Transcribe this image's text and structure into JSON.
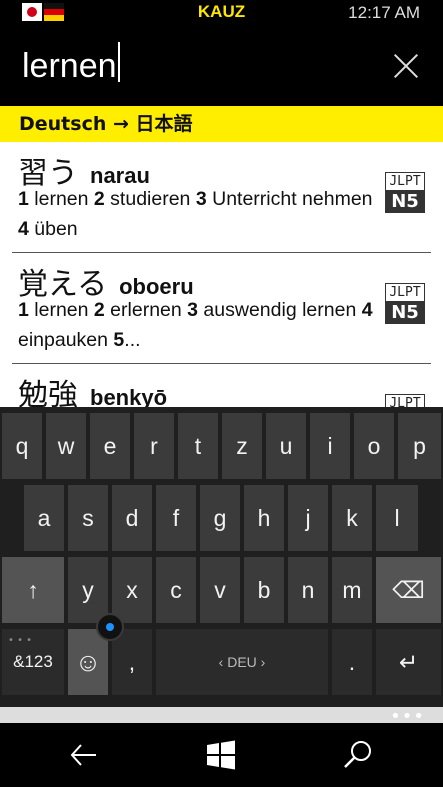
{
  "status": {
    "app_name": "KAUZ",
    "time": "12:17 AM"
  },
  "search": {
    "query": "lernen"
  },
  "direction_label": "Deutsch → 日本語",
  "results": [
    {
      "kanji": "習う",
      "romaji": "narau",
      "meanings": [
        {
          "n": "1",
          "text": " lernen "
        },
        {
          "n": "2",
          "text": " studieren "
        },
        {
          "n": "3",
          "text": " Unterricht nehmen "
        },
        {
          "n": "4",
          "text": " üben"
        }
      ],
      "jlpt_label": "JLPT",
      "jlpt_level": "N5"
    },
    {
      "kanji": "覚える",
      "romaji": "oboeru",
      "meanings": [
        {
          "n": "1",
          "text": " lernen "
        },
        {
          "n": "2",
          "text": " erlernen "
        },
        {
          "n": "3",
          "text": " auswendig lernen "
        },
        {
          "n": "4",
          "text": " einpauken "
        },
        {
          "n": "5",
          "text": "..."
        }
      ],
      "jlpt_label": "JLPT",
      "jlpt_level": "N5"
    },
    {
      "kanji": "勉強",
      "romaji": "benkyō",
      "jlpt_label": "JLPT"
    }
  ],
  "keyboard": {
    "row1": [
      "q",
      "w",
      "e",
      "r",
      "t",
      "z",
      "u",
      "i",
      "o",
      "p"
    ],
    "row2": [
      "a",
      "s",
      "d",
      "f",
      "g",
      "h",
      "j",
      "k",
      "l"
    ],
    "row3": [
      "y",
      "x",
      "c",
      "v",
      "b",
      "n",
      "m"
    ],
    "shift": "↑",
    "backspace": "⌫",
    "numbers": "&123",
    "emoji": "☺",
    "comma": ",",
    "space": "‹ DEU ›",
    "period": ".",
    "enter": "↵"
  },
  "colors": {
    "accent_yellow": "#ffee00",
    "title_yellow": "#ffe600",
    "keyboard_bg": "#1f1f1f",
    "cursor_blue": "#1e90ff"
  },
  "icons": {
    "japan_flag": "flag-jp-icon",
    "germany_flag": "flag-de-icon",
    "clear": "close-icon",
    "back": "back-arrow-icon",
    "home": "windows-logo-icon",
    "search": "search-icon"
  }
}
